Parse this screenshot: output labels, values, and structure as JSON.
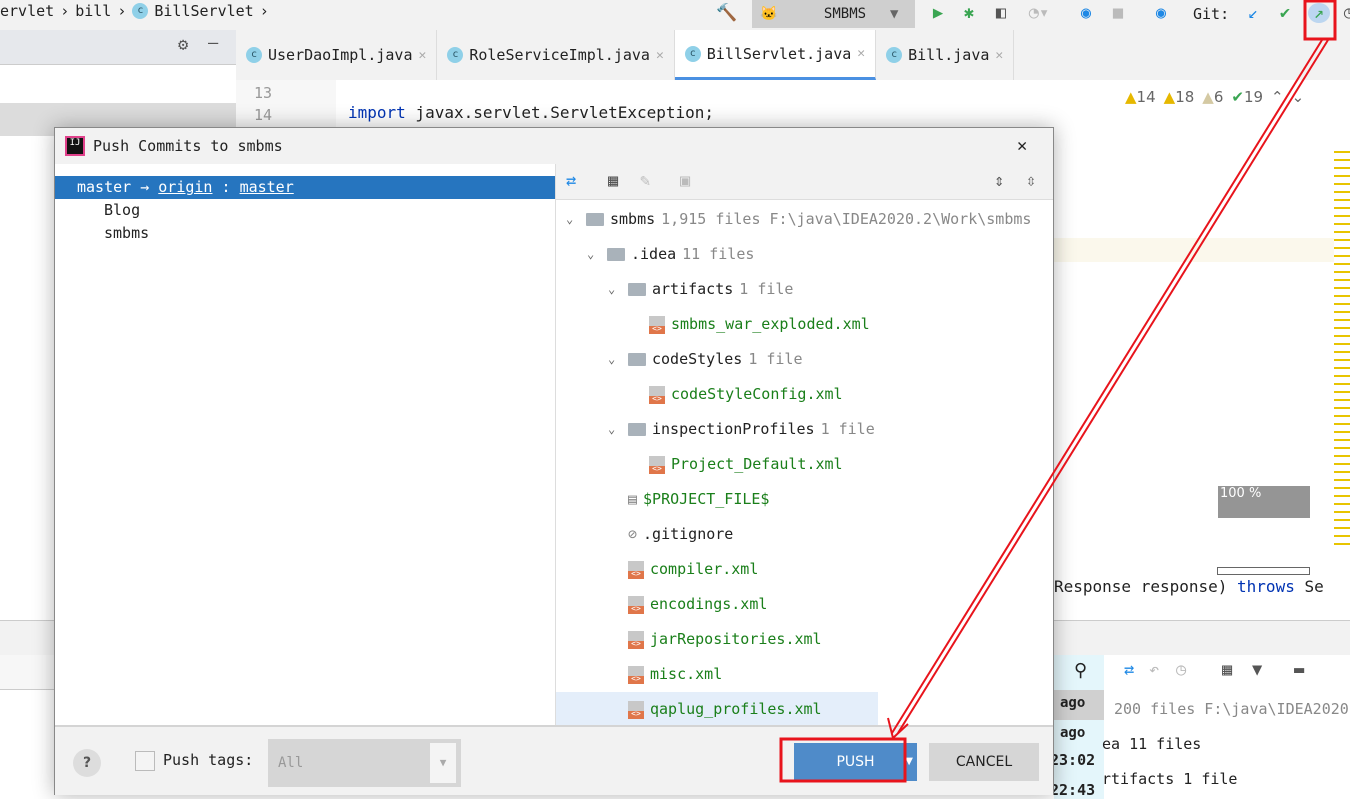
{
  "breadcrumb": [
    "ervlet",
    "bill",
    "BillServlet"
  ],
  "toolbar": {
    "run_config": "SMBMS",
    "git_label": "Git:"
  },
  "tabs": [
    {
      "label": "UserDaoImpl.java"
    },
    {
      "label": "RoleServiceImpl.java"
    },
    {
      "label": "BillServlet.java",
      "active": true
    },
    {
      "label": "Bill.java"
    }
  ],
  "editor": {
    "line_numbers": [
      "13",
      "14"
    ],
    "import_kw": "import",
    "import_rest": " javax.servlet.ServletException;",
    "bottom_code": "Response response) ",
    "throws_kw": "throws",
    "bottom_tail": " Se",
    "zoom": "100 %"
  },
  "inspections": {
    "errors": "14",
    "warnings": "18",
    "weak": "6",
    "typos": "19"
  },
  "dialog": {
    "title": "Push Commits to smbms",
    "branch": {
      "local": "master",
      "arrow": "→",
      "remote": "origin",
      "sep": ":",
      "remote_branch": "master"
    },
    "repos": [
      "Blog",
      "smbms"
    ],
    "tree": [
      {
        "level": 0,
        "type": "module",
        "name": "smbms",
        "info": "1,915 files  F:\\java\\IDEA2020.2\\Work\\smbms"
      },
      {
        "level": 1,
        "type": "folder",
        "name": ".idea",
        "info": "11 files"
      },
      {
        "level": 2,
        "type": "folder",
        "name": "artifacts",
        "info": "1 file"
      },
      {
        "level": 3,
        "type": "xml",
        "name": "smbms_war_exploded.xml",
        "new": true
      },
      {
        "level": 2,
        "type": "folder",
        "name": "codeStyles",
        "info": "1 file"
      },
      {
        "level": 3,
        "type": "xml",
        "name": "codeStyleConfig.xml",
        "new": true
      },
      {
        "level": 2,
        "type": "folder",
        "name": "inspectionProfiles",
        "info": "1 file"
      },
      {
        "level": 3,
        "type": "xml",
        "name": "Project_Default.xml",
        "new": true
      },
      {
        "level": 2,
        "type": "text",
        "name": "$PROJECT_FILE$",
        "new": true
      },
      {
        "level": 2,
        "type": "ignored",
        "name": ".gitignore",
        "new": false
      },
      {
        "level": 2,
        "type": "xml",
        "name": "compiler.xml",
        "new": true
      },
      {
        "level": 2,
        "type": "xml",
        "name": "encodings.xml",
        "new": true
      },
      {
        "level": 2,
        "type": "xml",
        "name": "jarRepositories.xml",
        "new": true
      },
      {
        "level": 2,
        "type": "xml",
        "name": "misc.xml",
        "new": true
      },
      {
        "level": 2,
        "type": "xml",
        "name": "qaplug_profiles.xml",
        "new": true
      }
    ],
    "help": "?",
    "push_tags_label": "Push tags:",
    "push_tags_value": "All",
    "push_label": "PUSH",
    "cancel_label": "CANCEL"
  },
  "background_panel": {
    "times": [
      "ago",
      "ago",
      "23:02",
      "22:43"
    ],
    "files_info": "200 files  F:\\java\\IDEA2020",
    "idea": "ea 11 files",
    "artifacts": "rtifacts 1 file"
  },
  "colors": {
    "accent": "#2675bf",
    "push": "#4f8bc9",
    "annotation": "#e8141c",
    "new_file": "#1a7f1a"
  }
}
